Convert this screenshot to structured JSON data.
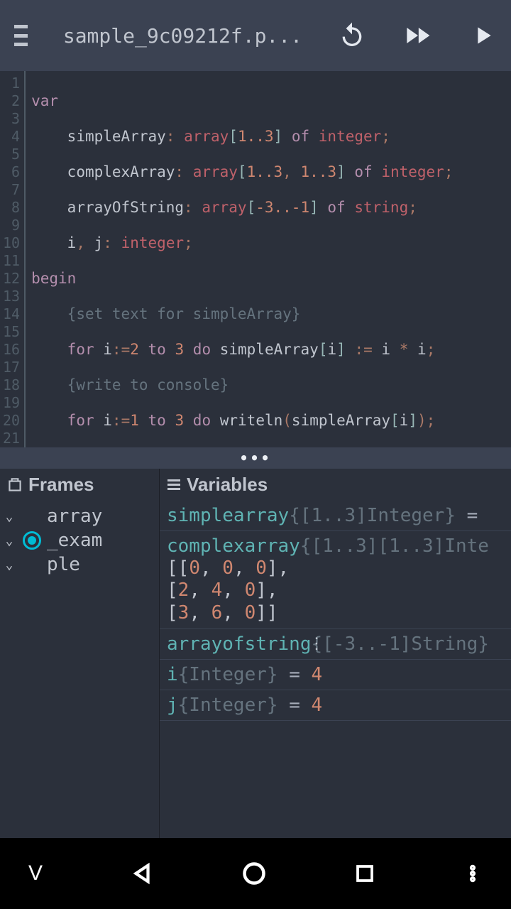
{
  "header": {
    "filename": "sample_9c09212f.p..."
  },
  "code": {
    "lines": 21
  },
  "debug": {
    "frames_title": "Frames",
    "variables_title": "Variables",
    "frame_items": [
      "array",
      "_exam",
      "ple"
    ],
    "variables": {
      "simplearray": {
        "name": "simplearray",
        "type": "{[1..3]Integer}",
        "eq": " = "
      },
      "complexarray": {
        "name": "complexarray",
        "type": "{[1..3][1..3]Inte"
      },
      "complexarray_val_l1": "[[0, 0, 0],",
      "complexarray_val_l2": "[2, 4, 0],",
      "complexarray_val_l3": "[3, 6, 0]]",
      "arrayofstring": {
        "name": "arrayofstring",
        "type": "{[-3..-1]String}"
      },
      "i": {
        "name": "i",
        "type": "{Integer}",
        "eq": " = ",
        "val": "4"
      },
      "j": {
        "name": "j",
        "type": "{Integer}",
        "eq": " = ",
        "val": "4"
      }
    }
  },
  "nav": {
    "v": "V"
  }
}
